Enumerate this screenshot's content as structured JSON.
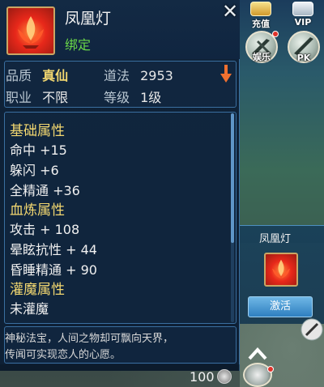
{
  "item": {
    "name": "凤凰灯",
    "bind_status": "绑定",
    "quality_label": "品质",
    "quality_value": "真仙",
    "daofa_label": "道法",
    "daofa_value": "2953",
    "career_label": "职业",
    "career_value": "不限",
    "level_label": "等级",
    "level_value": "1级"
  },
  "attributes": [
    {
      "text": "基础属性",
      "header": true
    },
    {
      "text": "命中 +15"
    },
    {
      "text": "躲闪 +6"
    },
    {
      "text": "全精通 +36"
    },
    {
      "text": "血炼属性",
      "header": true
    },
    {
      "text": "攻击 + 108"
    },
    {
      "text": "晕眩抗性 + 44"
    },
    {
      "text": "昏睡精通 + 90"
    },
    {
      "text": "灌魔属性",
      "header": true
    },
    {
      "text": "未灌魔"
    }
  ],
  "description": {
    "line1": "神秘法宝，人间之物却可飘向天界，",
    "line2": "传闻可实现恋人的心愿。"
  },
  "price": "100",
  "top_buttons": {
    "recharge": "充值",
    "vip": "VIP",
    "entertainment": "娱乐",
    "pk": "PK"
  },
  "side_card": {
    "name": "凤凰灯",
    "activate_label": "激活"
  },
  "colors": {
    "panel_bg": "#0f2238",
    "border": "#3a6fa0",
    "bind_green": "#6ad848",
    "section_gold": "#f2d770",
    "activate_blue": "#2e7fc0"
  },
  "icons": {
    "close": "close-icon",
    "item": "phoenix-lamp-icon",
    "sort": "arrow-down-icon",
    "coin": "silver-coin-icon"
  }
}
